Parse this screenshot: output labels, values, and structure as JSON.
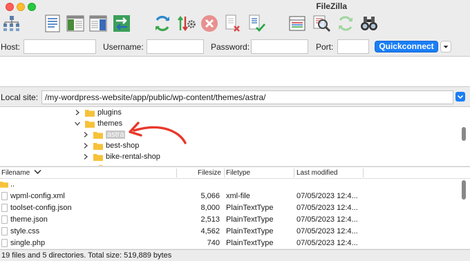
{
  "window": {
    "title": "FileZilla"
  },
  "toolbar": {
    "buttons": [
      {
        "name": "site-manager",
        "icon": "site-manager-icon"
      },
      {
        "name": "toggle-message-log",
        "icon": "message-log-icon"
      },
      {
        "name": "toggle-local-tree",
        "icon": "local-tree-icon"
      },
      {
        "name": "toggle-remote-tree",
        "icon": "remote-tree-icon"
      },
      {
        "name": "transfer-queue",
        "icon": "transfer-arrows-icon"
      },
      {
        "name": "refresh",
        "icon": "refresh-icon"
      },
      {
        "name": "process-queue",
        "icon": "process-queue-icon"
      },
      {
        "name": "cancel-operation",
        "icon": "cancel-icon"
      },
      {
        "name": "disconnect",
        "icon": "disconnect-icon"
      },
      {
        "name": "reconnect",
        "icon": "reconnect-icon"
      },
      {
        "name": "directory-filters",
        "icon": "filter-icon"
      },
      {
        "name": "toggle-comparison",
        "icon": "compare-icon"
      },
      {
        "name": "sync-browsing",
        "icon": "sync-icon"
      },
      {
        "name": "search-remote",
        "icon": "binoculars-icon"
      }
    ]
  },
  "quickconnect": {
    "host_label": "Host:",
    "username_label": "Username:",
    "password_label": "Password:",
    "port_label": "Port:",
    "host_value": "",
    "username_value": "",
    "password_value": "",
    "port_value": "",
    "button_label": "Quickconnect"
  },
  "local_site": {
    "label": "Local site:",
    "path": "/my-wordpress-website/app/public/wp-content/themes/astra/"
  },
  "tree": [
    {
      "label": "plugins",
      "expanded": false
    },
    {
      "label": "themes",
      "expanded": true
    },
    {
      "label": "astra",
      "selected": true
    },
    {
      "label": "best-shop"
    },
    {
      "label": "bike-rental-shop"
    }
  ],
  "annotation": {
    "color": "#e8382a",
    "icon": "red-arrow-annotation"
  },
  "file_list": {
    "columns": {
      "filename": "Filename",
      "filesize": "Filesize",
      "filetype": "Filetype",
      "last_modified": "Last modified"
    },
    "parent_label": "..",
    "rows": [
      {
        "name": "wpml-config.xml",
        "size": "5,066",
        "type": "xml-file",
        "modified": "07/05/2023 12:4..."
      },
      {
        "name": "toolset-config.json",
        "size": "8,000",
        "type": "PlainTextType",
        "modified": "07/05/2023 12:4..."
      },
      {
        "name": "theme.json",
        "size": "2,513",
        "type": "PlainTextType",
        "modified": "07/05/2023 12:4..."
      },
      {
        "name": "style.css",
        "size": "4,562",
        "type": "PlainTextType",
        "modified": "07/05/2023 12:4..."
      },
      {
        "name": "single.php",
        "size": "740",
        "type": "PlainTextType",
        "modified": "07/05/2023 12:4..."
      }
    ]
  },
  "status": {
    "text": "19 files and 5 directories. Total size: 519,889 bytes"
  },
  "colors": {
    "accent": "#1a7ef6",
    "folder": "#f7c23a",
    "selection": "#c8c8c8"
  }
}
